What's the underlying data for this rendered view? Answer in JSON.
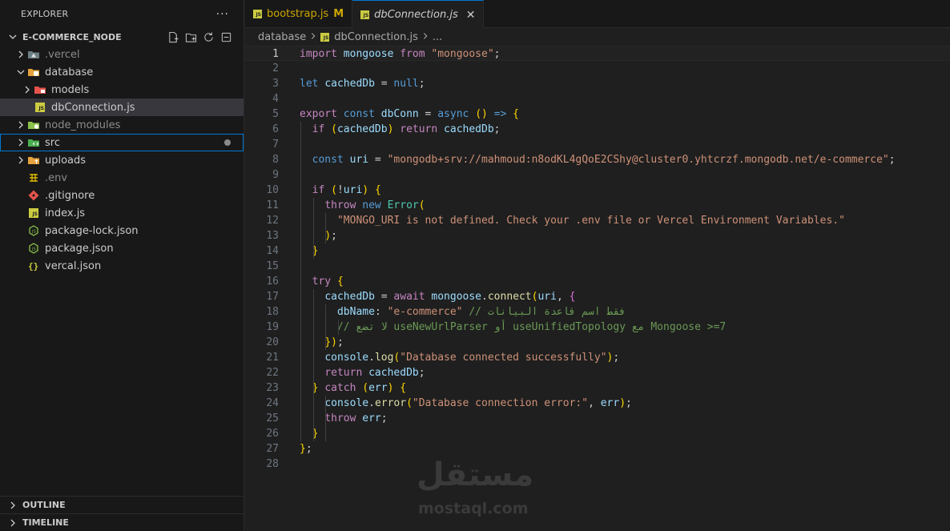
{
  "explorer": {
    "title": "EXPLORER",
    "more_label": "···",
    "project": "E-COMMERCE_NODE",
    "tree": [
      {
        "label": ".vercel",
        "type": "folder",
        "icon": "vercel-folder-icon",
        "depth": 1,
        "expanded": false,
        "dim": true
      },
      {
        "label": "database",
        "type": "folder",
        "icon": "database-folder-icon",
        "depth": 1,
        "expanded": true
      },
      {
        "label": "models",
        "type": "folder",
        "icon": "models-folder-icon",
        "depth": 2,
        "expanded": false
      },
      {
        "label": "dbConnection.js",
        "type": "file",
        "icon": "js-file-icon",
        "depth": 2,
        "selected": true
      },
      {
        "label": "node_modules",
        "type": "folder",
        "icon": "node-modules-folder-icon",
        "depth": 1,
        "expanded": false,
        "dim": true
      },
      {
        "label": "src",
        "type": "folder",
        "icon": "src-folder-icon",
        "depth": 1,
        "expanded": false,
        "focused": true,
        "modified": true
      },
      {
        "label": "uploads",
        "type": "folder",
        "icon": "uploads-folder-icon",
        "depth": 1,
        "expanded": false
      },
      {
        "label": ".env",
        "type": "file",
        "icon": "env-file-icon",
        "depth": 1,
        "dim": true
      },
      {
        "label": ".gitignore",
        "type": "file",
        "icon": "git-file-icon",
        "depth": 1
      },
      {
        "label": "index.js",
        "type": "file",
        "icon": "js-file-icon",
        "depth": 1
      },
      {
        "label": "package-lock.json",
        "type": "file",
        "icon": "npm-file-icon",
        "depth": 1
      },
      {
        "label": "package.json",
        "type": "file",
        "icon": "npm-file-icon",
        "depth": 1
      },
      {
        "label": "vercal.json",
        "type": "file",
        "icon": "json-file-icon",
        "depth": 1
      }
    ],
    "outline_label": "OUTLINE",
    "timeline_label": "TIMELINE"
  },
  "tabs": [
    {
      "label": "bootstrap.js",
      "badge": "M",
      "active": false
    },
    {
      "label": "dbConnection.js",
      "active": true,
      "close": "✕"
    }
  ],
  "breadcrumb": {
    "folder": "database",
    "file": "dbConnection.js",
    "tail": "..."
  },
  "editor": {
    "active_line": 1,
    "lines": [
      "import mongoose from \"mongoose\";",
      "",
      "let cachedDb = null;",
      "",
      "export const dbConn = async () => {",
      "  if (cachedDb) return cachedDb;",
      "",
      "  const uri = \"mongodb+srv://mahmoud:n8odKL4gQoE2CShy@cluster0.yhtcrzf.mongodb.net/e-commerce\";",
      "",
      "  if (!uri) {",
      "    throw new Error(",
      "      \"MONGO_URI is not defined. Check your .env file or Vercel Environment Variables.\"",
      "    );",
      "  }",
      "",
      "  try {",
      "    cachedDb = await mongoose.connect(uri, {",
      "      dbName: \"e-commerce\" // فقط اسم قاعدة البيانات",
      "      // لا تضع useNewUrlParser أو useUnifiedTopology مع Mongoose >=7",
      "    });",
      "    console.log(\"Database connected successfully\");",
      "    return cachedDb;",
      "  } catch (err) {",
      "    console.error(\"Database connection error:\", err);",
      "    throw err;",
      "  }",
      "};",
      ""
    ]
  },
  "watermark": {
    "arabic": "مستقل",
    "latin": "mostaql.com"
  },
  "colors": {
    "accent": "#0078d4",
    "js": "#cbcb41",
    "modified": "#cca700",
    "background": "#1f1f1f",
    "sidebar": "#181818"
  }
}
